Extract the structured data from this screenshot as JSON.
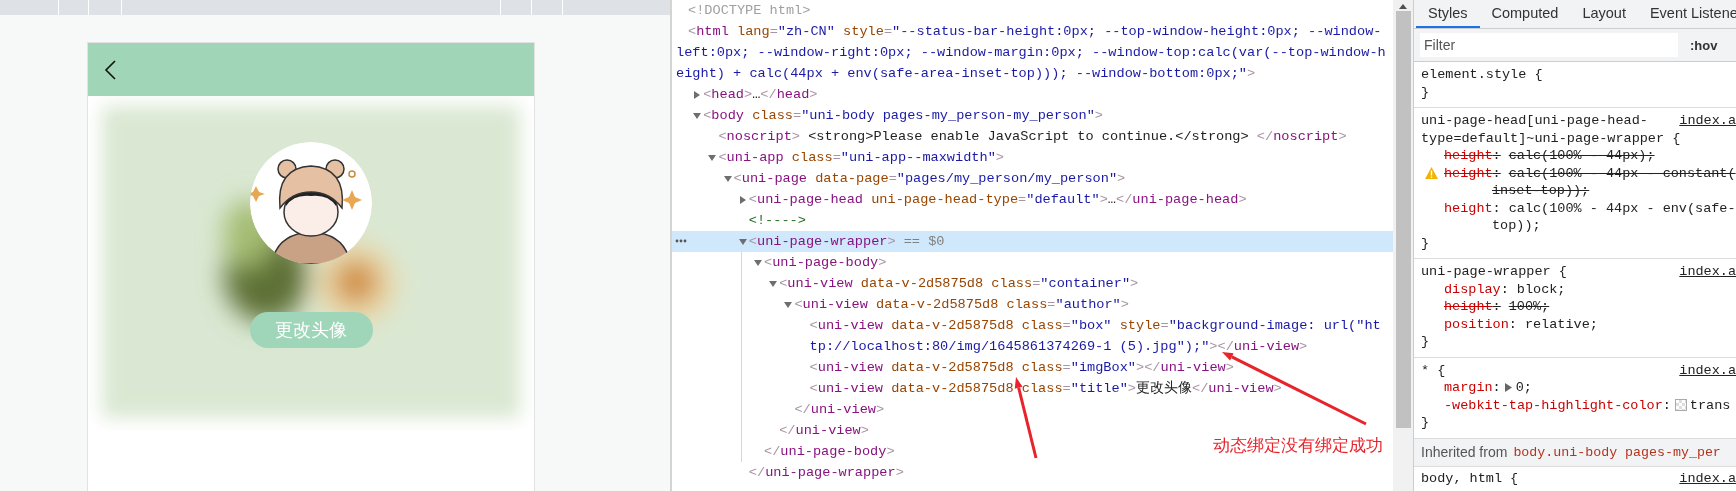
{
  "simulator": {
    "change_avatar_button": "更改头像"
  },
  "elements": {
    "nodes": [
      {
        "kind": "doctype",
        "lines": [
          "<!DOCTYPE html>"
        ],
        "selected": false
      },
      {
        "kind": "element",
        "lines": [
          "<html lang=\"zh-CN\" style=\"--status-bar-height:0px; --top-window-height:0px; --window-",
          "left:0px; --window-right:0px; --window-margin:0px; --window-top:calc(var(--top-window-h",
          "eight) + calc(44px + env(safe-area-inset-top))); --window-bottom:0px;\">"
        ],
        "selected": false,
        "children": [
          {
            "kind": "element",
            "lines": [
              "<head>…</head>"
            ],
            "expanded": false,
            "selected": false
          },
          {
            "kind": "element",
            "lines": [
              "<body class=\"uni-body pages-my_person-my_person\">"
            ],
            "expanded": true,
            "selected": false,
            "children": [
              {
                "kind": "element",
                "lines": [
                  "<noscript>"
                ],
                "content": " <strong>Please enable JavaScript to continue.</strong> ",
                "end_tag": "</noscript>",
                "selected": false
              },
              {
                "kind": "element",
                "lines": [
                  "<uni-app class=\"uni-app--maxwidth\">"
                ],
                "expanded": true,
                "selected": false,
                "children": [
                  {
                    "kind": "element",
                    "lines": [
                      "<uni-page data-page=\"pages/my_person/my_person\">"
                    ],
                    "expanded": true,
                    "selected": false,
                    "children": [
                      {
                        "kind": "element",
                        "lines": [
                          "<uni-page-head uni-page-head-type=\"default\">…</uni-page-head>"
                        ],
                        "expanded": false,
                        "selected": false
                      },
                      {
                        "kind": "comment",
                        "lines": [
                          "<!---->"
                        ],
                        "selected": false
                      },
                      {
                        "kind": "element",
                        "lines": [
                          "<uni-page-wrapper>"
                        ],
                        "console_ref": "== $0",
                        "expanded": true,
                        "selected": true,
                        "closing": "</uni-page-wrapper>",
                        "children": [
                          {
                            "kind": "element",
                            "lines": [
                              "<uni-page-body>"
                            ],
                            "expanded": true,
                            "selected": false,
                            "closing": "</uni-page-body>",
                            "children": [
                              {
                                "kind": "element",
                                "lines": [
                                  "<uni-view data-v-2d5875d8 class=\"container\">"
                                ],
                                "expanded": true,
                                "selected": false,
                                "closing": "</uni-view>",
                                "children": [
                                  {
                                    "kind": "element",
                                    "lines": [
                                      "<uni-view data-v-2d5875d8 class=\"author\">"
                                    ],
                                    "expanded": true,
                                    "selected": false,
                                    "closing": "</uni-view>",
                                    "children": [
                                      {
                                        "kind": "element",
                                        "lines": [
                                          "<uni-view data-v-2d5875d8 class=\"box\" style=\"background-image: url(\"ht",
                                          "tp://localhost:80/img/1645861374269-1 (5).jpg\");\"></uni-view>"
                                        ],
                                        "selected": false
                                      },
                                      {
                                        "kind": "element",
                                        "lines": [
                                          "<uni-view data-v-2d5875d8 class=\"imgBox\"></uni-view>"
                                        ],
                                        "selected": false
                                      },
                                      {
                                        "kind": "element",
                                        "lines": [
                                          "<uni-view data-v-2d5875d8 class=\"title\">"
                                        ],
                                        "content": "更改头像",
                                        "end_tag": "</uni-view>",
                                        "selected": false
                                      }
                                    ]
                                  }
                                ]
                              }
                            ]
                          }
                        ]
                      }
                    ]
                  }
                ]
              }
            ]
          }
        ]
      }
    ]
  },
  "annotation": {
    "text": "动态绑定没有绑定成功"
  },
  "styles": {
    "tabs": [
      {
        "label": "Styles",
        "selected": true
      },
      {
        "label": "Computed",
        "selected": false
      },
      {
        "label": "Layout",
        "selected": false
      },
      {
        "label": "Event Listene",
        "selected": false
      }
    ],
    "filter": {
      "placeholder": "Filter"
    },
    "hover_toggle": ":hov",
    "rules": [
      {
        "selector": [
          "element.style {"
        ],
        "close": "}"
      },
      {
        "selector": [
          "uni-page-head[uni-page-head-",
          "type=default]~uni-page-wrapper {"
        ],
        "source": "index.a",
        "declarations": [
          {
            "property": "height:",
            "value": "calc(100% - 44px);",
            "overridden": true,
            "warning": false,
            "expandable": false,
            "swatch": false
          },
          {
            "property": "height:",
            "value": "calc(100% - 44px - constant(",
            "continuation": "inset-top));",
            "overridden": true,
            "warning": true,
            "expandable": false,
            "swatch": false
          },
          {
            "property": "height:",
            "value": "calc(100% - 44px - env(safe-",
            "continuation": "top));",
            "overridden": false,
            "warning": false,
            "expandable": false,
            "swatch": false
          }
        ],
        "close": "}"
      },
      {
        "selector": [
          "uni-page-wrapper {"
        ],
        "source": "index.a",
        "declarations": [
          {
            "property": "display:",
            "value": "block;",
            "overridden": false,
            "warning": false,
            "expandable": false,
            "swatch": false
          },
          {
            "property": "height:",
            "value": "100%;",
            "overridden": true,
            "warning": false,
            "expandable": false,
            "swatch": false
          },
          {
            "property": "position:",
            "value": "relative;",
            "overridden": false,
            "warning": false,
            "expandable": false,
            "swatch": false
          }
        ],
        "close": "}"
      },
      {
        "selector": [
          "* {"
        ],
        "source": "index.a",
        "declarations": [
          {
            "property": "margin:",
            "value": "0;",
            "overridden": false,
            "warning": false,
            "expandable": true,
            "swatch": false
          },
          {
            "property": "-webkit-tap-highlight-color:",
            "value": "trans",
            "overridden": false,
            "warning": false,
            "expandable": false,
            "swatch": true
          }
        ],
        "close": "}"
      }
    ],
    "inherited": {
      "label": "Inherited from",
      "selector": "body.uni-body pages-my_per"
    },
    "next_rule": {
      "selector": "body, html {",
      "source": "index.a"
    }
  }
}
